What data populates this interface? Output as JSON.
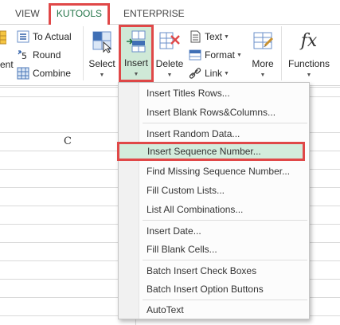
{
  "tabs": {
    "view": "VIEW",
    "kutools": "KUTOOLS",
    "enterprise": "ENTERPRISE"
  },
  "ribbon": {
    "left_group": {
      "partial_label": "ent",
      "to_actual": "To Actual",
      "round": "Round",
      "combine": "Combine"
    },
    "select": "Select",
    "insert": "Insert",
    "delete": "Delete",
    "text": "Text",
    "format": "Format",
    "link": "Link",
    "more": "More",
    "functions": "Functions",
    "functions_icon_text": "fx",
    "round_icon_text": "5"
  },
  "sheet": {
    "column_header": "C"
  },
  "insert_menu": {
    "items": [
      "Insert Titles Rows...",
      "Insert Blank Rows&Columns...",
      "Insert Random Data...",
      "Insert Sequence Number...",
      "Find Missing Sequence Number...",
      "Fill Custom Lists...",
      "List All Combinations...",
      "Insert Date...",
      "Fill Blank Cells...",
      "Batch Insert Check Boxes",
      "Batch Insert Option Buttons",
      "AutoText"
    ]
  },
  "colors": {
    "accent_green": "#217346",
    "highlight_red": "#e04848",
    "selected_fill": "#cfe9d7"
  }
}
